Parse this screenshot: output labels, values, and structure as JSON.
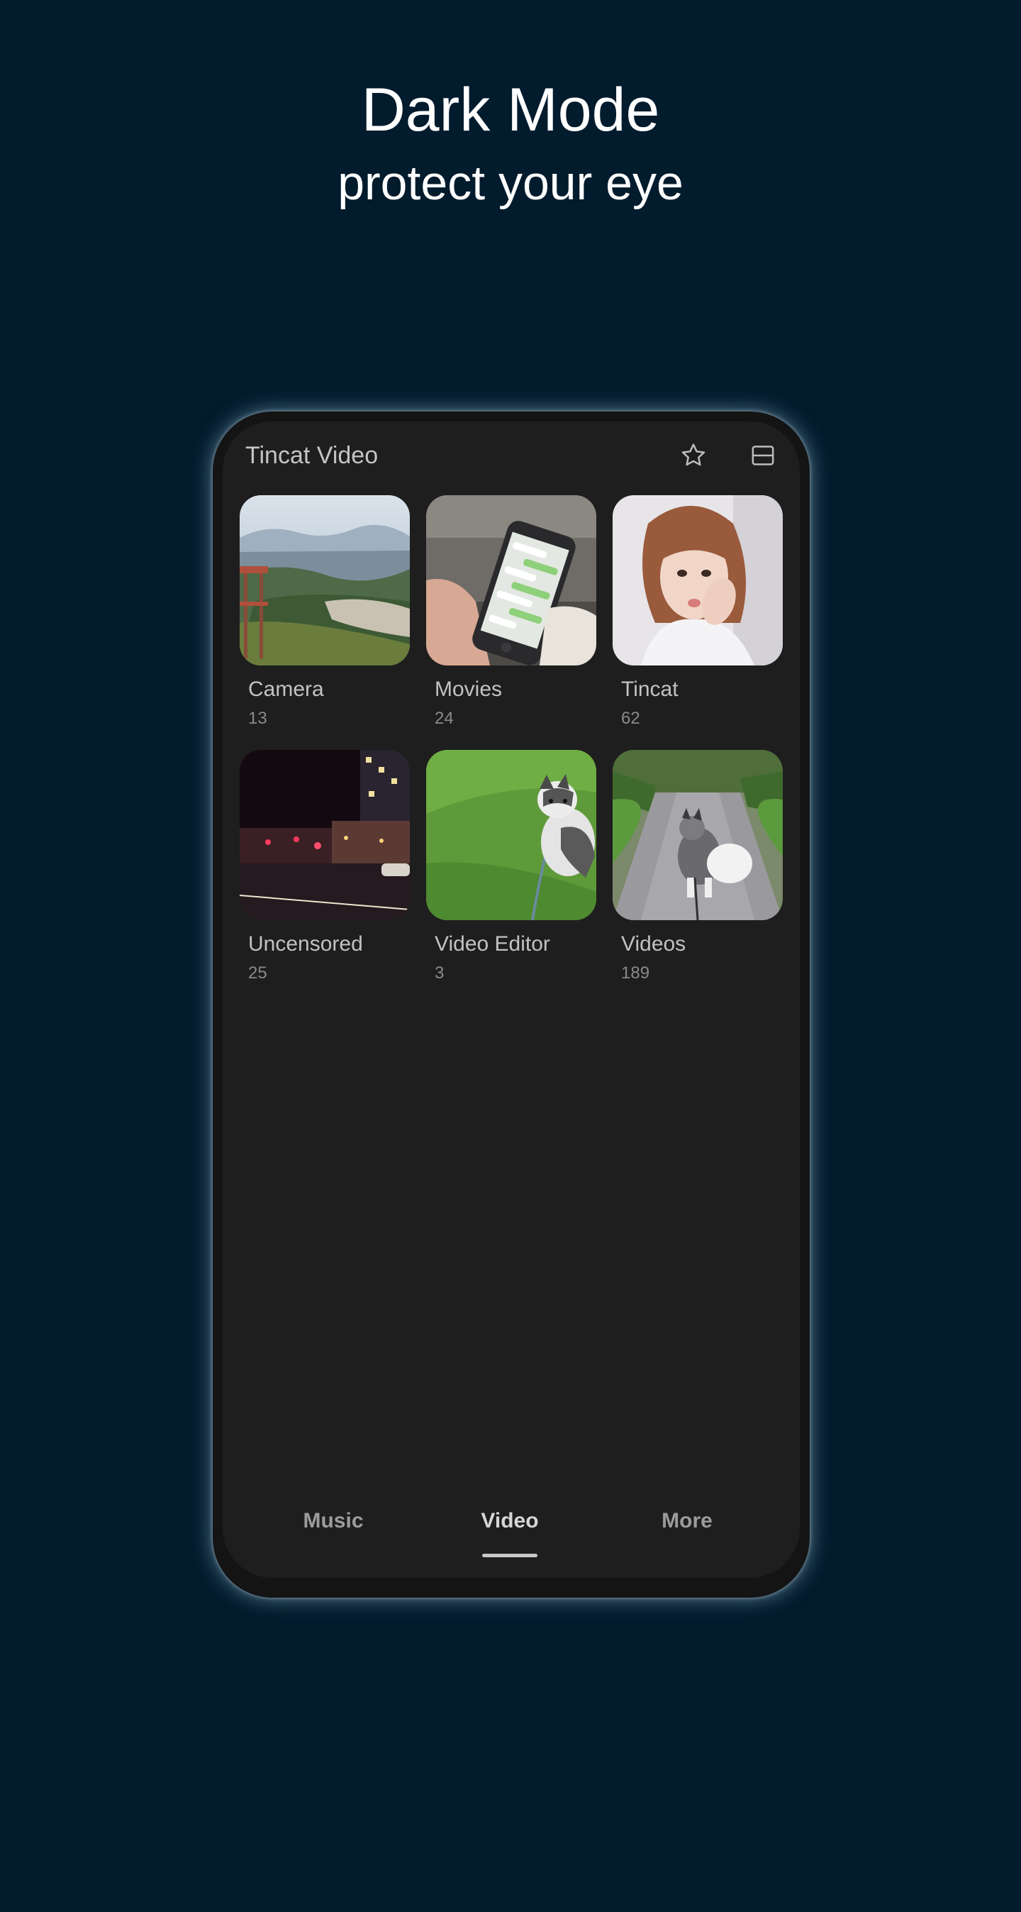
{
  "promo": {
    "title": "Dark Mode",
    "subtitle": "protect your eye"
  },
  "app": {
    "title": "Tincat Video",
    "icons": [
      "star-icon",
      "layout-toggle-icon"
    ]
  },
  "albums": [
    {
      "name": "Camera",
      "count": "13"
    },
    {
      "name": "Movies",
      "count": "24"
    },
    {
      "name": "Tincat",
      "count": "62"
    },
    {
      "name": "Uncensored",
      "count": "25"
    },
    {
      "name": "Video Editor",
      "count": "3"
    },
    {
      "name": "Videos",
      "count": "189"
    }
  ],
  "nav": {
    "items": [
      "Music",
      "Video",
      "More"
    ],
    "active": "Video"
  },
  "colors": {
    "page_background": "#021b2d",
    "screen_background": "#1e1e1e",
    "glow": "#aacde1"
  }
}
